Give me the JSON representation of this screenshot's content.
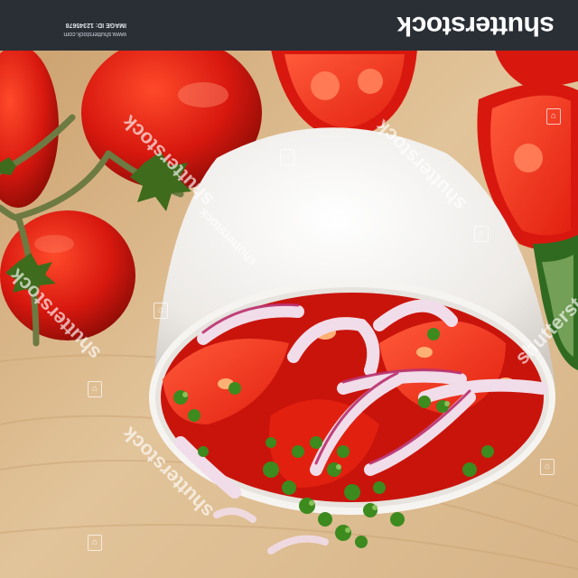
{
  "image": {
    "description_colors": {
      "board": "#d6b486",
      "tomato": "#d8180f",
      "bowl": "#f3f1ee",
      "onion": "#e8c7dc",
      "chive": "#3d8a1f",
      "bar": "#2a2f36"
    }
  },
  "banner": {
    "logo": "shutterstock",
    "info_line1": "www.shutterstock.com",
    "info_line2": "IMAGE ID: 12345678"
  },
  "watermarks": [
    "shutterstock",
    "shutterstock",
    "shutterstock",
    "shutterstock",
    "shutterstock",
    "shutterstock"
  ]
}
